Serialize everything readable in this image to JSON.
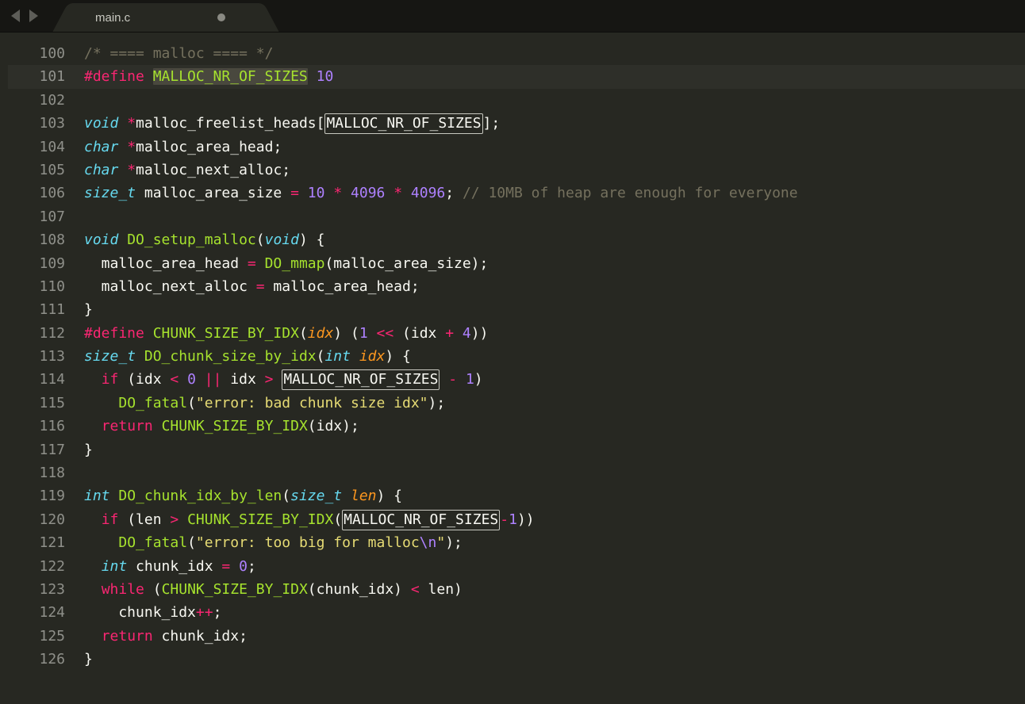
{
  "tab": {
    "filename": "main.c",
    "dirty": true
  },
  "gutter_start": 100,
  "selected_word": "MALLOC_NR_OF_SIZES",
  "current_line_index": 1,
  "lines": [
    [
      {
        "t": "c",
        "v": "/* ==== malloc ==== */"
      }
    ],
    [
      {
        "t": "kw",
        "v": "#define"
      },
      {
        "t": "nm",
        "v": " "
      },
      {
        "t": "fn",
        "cls": "selword",
        "v": "MALLOC_NR_OF_SIZES"
      },
      {
        "t": "nm",
        "v": " "
      },
      {
        "t": "nu",
        "v": "10"
      }
    ],
    [],
    [
      {
        "t": "ty",
        "v": "void"
      },
      {
        "t": "nm",
        "v": " "
      },
      {
        "t": "op",
        "v": "*"
      },
      {
        "t": "nm",
        "v": "malloc_freelist_heads["
      },
      {
        "t": "nm",
        "cls": "boxed",
        "v": "MALLOC_NR_OF_SIZES"
      },
      {
        "t": "nm",
        "v": "];"
      }
    ],
    [
      {
        "t": "ty",
        "v": "char"
      },
      {
        "t": "nm",
        "v": " "
      },
      {
        "t": "op",
        "v": "*"
      },
      {
        "t": "nm",
        "v": "malloc_area_head;"
      }
    ],
    [
      {
        "t": "ty",
        "v": "char"
      },
      {
        "t": "nm",
        "v": " "
      },
      {
        "t": "op",
        "v": "*"
      },
      {
        "t": "nm",
        "v": "malloc_next_alloc;"
      }
    ],
    [
      {
        "t": "ty",
        "v": "size_t"
      },
      {
        "t": "nm",
        "v": " malloc_area_size "
      },
      {
        "t": "op",
        "v": "="
      },
      {
        "t": "nm",
        "v": " "
      },
      {
        "t": "nu",
        "v": "10"
      },
      {
        "t": "nm",
        "v": " "
      },
      {
        "t": "op",
        "v": "*"
      },
      {
        "t": "nm",
        "v": " "
      },
      {
        "t": "nu",
        "v": "4096"
      },
      {
        "t": "nm",
        "v": " "
      },
      {
        "t": "op",
        "v": "*"
      },
      {
        "t": "nm",
        "v": " "
      },
      {
        "t": "nu",
        "v": "4096"
      },
      {
        "t": "nm",
        "v": "; "
      },
      {
        "t": "c",
        "v": "// 10MB of heap are enough for everyone"
      }
    ],
    [],
    [
      {
        "t": "ty",
        "v": "void"
      },
      {
        "t": "nm",
        "v": " "
      },
      {
        "t": "fn",
        "v": "DO_setup_malloc"
      },
      {
        "t": "nm",
        "v": "("
      },
      {
        "t": "ty",
        "v": "void"
      },
      {
        "t": "nm",
        "v": ") {"
      }
    ],
    [
      {
        "t": "nm",
        "v": "  malloc_area_head "
      },
      {
        "t": "op",
        "v": "="
      },
      {
        "t": "nm",
        "v": " "
      },
      {
        "t": "fn",
        "v": "DO_mmap"
      },
      {
        "t": "nm",
        "v": "(malloc_area_size);"
      }
    ],
    [
      {
        "t": "nm",
        "v": "  malloc_next_alloc "
      },
      {
        "t": "op",
        "v": "="
      },
      {
        "t": "nm",
        "v": " malloc_area_head;"
      }
    ],
    [
      {
        "t": "nm",
        "v": "}"
      }
    ],
    [
      {
        "t": "kw",
        "v": "#define"
      },
      {
        "t": "nm",
        "v": " "
      },
      {
        "t": "fn",
        "v": "CHUNK_SIZE_BY_IDX"
      },
      {
        "t": "nm",
        "v": "("
      },
      {
        "t": "pa",
        "v": "idx"
      },
      {
        "t": "nm",
        "v": ") ("
      },
      {
        "t": "nu",
        "v": "1"
      },
      {
        "t": "nm",
        "v": " "
      },
      {
        "t": "op",
        "v": "<<"
      },
      {
        "t": "nm",
        "v": " (idx "
      },
      {
        "t": "op",
        "v": "+"
      },
      {
        "t": "nm",
        "v": " "
      },
      {
        "t": "nu",
        "v": "4"
      },
      {
        "t": "nm",
        "v": "))"
      }
    ],
    [
      {
        "t": "ty",
        "v": "size_t"
      },
      {
        "t": "nm",
        "v": " "
      },
      {
        "t": "fn",
        "v": "DO_chunk_size_by_idx"
      },
      {
        "t": "nm",
        "v": "("
      },
      {
        "t": "ty",
        "v": "int"
      },
      {
        "t": "nm",
        "v": " "
      },
      {
        "t": "pa",
        "v": "idx"
      },
      {
        "t": "nm",
        "v": ") {"
      }
    ],
    [
      {
        "t": "nm",
        "v": "  "
      },
      {
        "t": "kw",
        "v": "if"
      },
      {
        "t": "nm",
        "v": " (idx "
      },
      {
        "t": "op",
        "v": "<"
      },
      {
        "t": "nm",
        "v": " "
      },
      {
        "t": "nu",
        "v": "0"
      },
      {
        "t": "nm",
        "v": " "
      },
      {
        "t": "op",
        "v": "||"
      },
      {
        "t": "nm",
        "v": " idx "
      },
      {
        "t": "op",
        "v": ">"
      },
      {
        "t": "nm",
        "v": " "
      },
      {
        "t": "nm",
        "cls": "boxed",
        "v": "MALLOC_NR_OF_SIZES"
      },
      {
        "t": "nm",
        "v": " "
      },
      {
        "t": "op",
        "v": "-"
      },
      {
        "t": "nm",
        "v": " "
      },
      {
        "t": "nu",
        "v": "1"
      },
      {
        "t": "nm",
        "v": ")"
      }
    ],
    [
      {
        "t": "nm",
        "v": "    "
      },
      {
        "t": "fn",
        "v": "DO_fatal"
      },
      {
        "t": "nm",
        "v": "("
      },
      {
        "t": "st",
        "v": "\"error: bad chunk size idx\""
      },
      {
        "t": "nm",
        "v": ");"
      }
    ],
    [
      {
        "t": "nm",
        "v": "  "
      },
      {
        "t": "kw",
        "v": "return"
      },
      {
        "t": "nm",
        "v": " "
      },
      {
        "t": "fn",
        "v": "CHUNK_SIZE_BY_IDX"
      },
      {
        "t": "nm",
        "v": "(idx);"
      }
    ],
    [
      {
        "t": "nm",
        "v": "}"
      }
    ],
    [],
    [
      {
        "t": "ty",
        "v": "int"
      },
      {
        "t": "nm",
        "v": " "
      },
      {
        "t": "fn",
        "v": "DO_chunk_idx_by_len"
      },
      {
        "t": "nm",
        "v": "("
      },
      {
        "t": "ty",
        "v": "size_t"
      },
      {
        "t": "nm",
        "v": " "
      },
      {
        "t": "pa",
        "v": "len"
      },
      {
        "t": "nm",
        "v": ") {"
      }
    ],
    [
      {
        "t": "nm",
        "v": "  "
      },
      {
        "t": "kw",
        "v": "if"
      },
      {
        "t": "nm",
        "v": " (len "
      },
      {
        "t": "op",
        "v": ">"
      },
      {
        "t": "nm",
        "v": " "
      },
      {
        "t": "fn",
        "v": "CHUNK_SIZE_BY_IDX"
      },
      {
        "t": "nm",
        "v": "("
      },
      {
        "t": "nm",
        "cls": "boxed",
        "v": "MALLOC_NR_OF_SIZES"
      },
      {
        "t": "op",
        "v": "-"
      },
      {
        "t": "nu",
        "v": "1"
      },
      {
        "t": "nm",
        "v": "))"
      }
    ],
    [
      {
        "t": "nm",
        "v": "    "
      },
      {
        "t": "fn",
        "v": "DO_fatal"
      },
      {
        "t": "nm",
        "v": "("
      },
      {
        "t": "st",
        "v": "\"error: too big for malloc"
      },
      {
        "t": "esc",
        "v": "\\n"
      },
      {
        "t": "st",
        "v": "\""
      },
      {
        "t": "nm",
        "v": ");"
      }
    ],
    [
      {
        "t": "nm",
        "v": "  "
      },
      {
        "t": "ty",
        "v": "int"
      },
      {
        "t": "nm",
        "v": " chunk_idx "
      },
      {
        "t": "op",
        "v": "="
      },
      {
        "t": "nm",
        "v": " "
      },
      {
        "t": "nu",
        "v": "0"
      },
      {
        "t": "nm",
        "v": ";"
      }
    ],
    [
      {
        "t": "nm",
        "v": "  "
      },
      {
        "t": "kw",
        "v": "while"
      },
      {
        "t": "nm",
        "v": " ("
      },
      {
        "t": "fn",
        "v": "CHUNK_SIZE_BY_IDX"
      },
      {
        "t": "nm",
        "v": "(chunk_idx) "
      },
      {
        "t": "op",
        "v": "<"
      },
      {
        "t": "nm",
        "v": " len)"
      }
    ],
    [
      {
        "t": "nm",
        "v": "    chunk_idx"
      },
      {
        "t": "op",
        "v": "++"
      },
      {
        "t": "nm",
        "v": ";"
      }
    ],
    [
      {
        "t": "nm",
        "v": "  "
      },
      {
        "t": "kw",
        "v": "return"
      },
      {
        "t": "nm",
        "v": " chunk_idx;"
      }
    ],
    [
      {
        "t": "nm",
        "v": "}"
      }
    ]
  ]
}
